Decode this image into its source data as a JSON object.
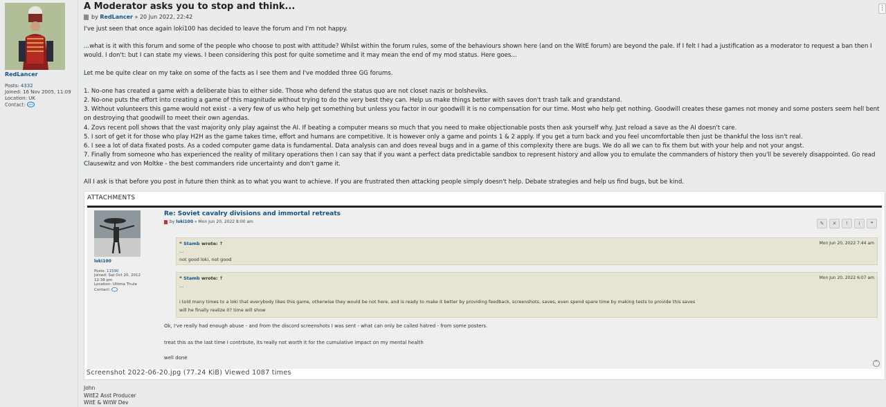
{
  "profile": {
    "username": "RedLancer",
    "posts_label": "Posts:",
    "posts_value": "4332",
    "joined_label": "Joined:",
    "joined_value": "16 Nov 2005, 11:09",
    "location_label": "Location:",
    "location_value": "UK",
    "contact_label": "Contact:"
  },
  "post": {
    "title": "A Moderator asks you to stop and think...",
    "by_label": "by",
    "author": "RedLancer",
    "date": "» 20 Jun 2022, 22:42",
    "paragraphs": [
      "I've just seen that once again loki100 has decided to leave the forum and I'm not happy.",
      "...what is it with this forum and some of the people who choose to post with attitude? Whilst within the forum rules, some of the behaviours shown here (and on the WitE forum) are beyond the pale. If I felt I had a justification as a moderator to request a ban then I would. I don't: but I can state my views. I been considering this post for quite sometime and it may mean the end of my mod status. Here goes...",
      "Let me be quite clear on my take on some of the facts as I see them and I've modded three GG forums.",
      "1. No-one has created a game with a deliberate bias to either side. Those who defend the status quo are not closet nazis or bolsheviks.",
      "2. No-one puts the effort into creating a game of this magnitude without trying to do the very best they can. Help us make things better with saves don't trash talk and grandstand.",
      "3. Without volunteers this game would not exist - a very few of us who help get something but unless you factor in our goodwill it is no compensation for our time. Most who help get nothing. Goodwill creates these games not money and some posters seem hell bent on destroying that goodwill to meet their own agendas.",
      "4. Zovs recent poll shows that the vast majority only play against the AI. If beating a computer means so much that you need to make objectionable posts then ask yourself why. Just reload a save as the AI doesn't care.",
      "5. I sort of get it for those who play H2H as the game takes time, effort and humans are competitive. It is however only a game and points 1 & 2 apply. If you get a turn back and you feel uncomfortable then just be thankful the loss isn't real.",
      "6. I see a lot of data fixated posts. As a coded computer game data is fundamental. Data analysis can and does reveal bugs and in a game of this complexity there are bugs. We do all we can to fix them but with your help and not your angst.",
      "7. Finally from someone who has experienced the reality of military operations then I can say that if you want a perfect data predictable sandbox to represent history and allow you to emulate the commanders of history then you'll be severely disappointed. Go read Clausewitz and von Moltke - the best commanders ride uncertainty and don't game it.",
      "All I ask is that before you post in future then think as to what you want to achieve. If you are frustrated then attacking people simply doesn't help. Debate strategies and help us find bugs, but be kind."
    ]
  },
  "attachments": {
    "heading": "ATTACHMENTS",
    "caption": "Screenshot 2022-06-20.jpg (77.24 KiB) Viewed 1087 times",
    "screenshot": {
      "profile": {
        "username": "loki100",
        "posts_label": "Posts:",
        "posts_value": "11590",
        "joined_label": "Joined:",
        "joined_value": "Sat Oct 20, 2012 12:38 pm",
        "location_label": "Location:",
        "location_value": "Ultima Thule",
        "contact_label": "Contact:"
      },
      "title": "Re: Soviet cavalry divisions and immortal retreats",
      "by_label": "by",
      "author": "loki100",
      "date": "» Mon Jun 20, 2022 8:00 am",
      "quotes": [
        {
          "author": "Stamb",
          "wrote": "wrote: ↑",
          "date": "Mon Jun 20, 2022 7:44 am",
          "lines": [
            "...",
            "not good loki, not good"
          ]
        },
        {
          "author": "Stamb",
          "wrote": "wrote: ↑",
          "date": "Mon Jun 20, 2022 6:07 am",
          "lines": [
            "...",
            "i told many times to a loki that everybody likes this game, otherwise they would be not here, and is ready to make it better by providing feedback, screenshots, saves, even spend spare time by making tests to provide this saves",
            "will he finally realize it? time will show"
          ]
        }
      ],
      "body": [
        "Ok, I've really had enough abuse - and from the discord screenshots I was sent - what can only be called hatred - from some posters.",
        "treat this as the last time I contrbute, its really not worth it for the cumulative impact on my mental health",
        "well done"
      ]
    }
  },
  "signature": [
    "John",
    "WitE2 Asst Producer",
    "WitE & WitW Dev"
  ],
  "colors": {
    "background": "#e9ebec",
    "link": "#105289",
    "quote_bg": "#e6e5d3"
  }
}
